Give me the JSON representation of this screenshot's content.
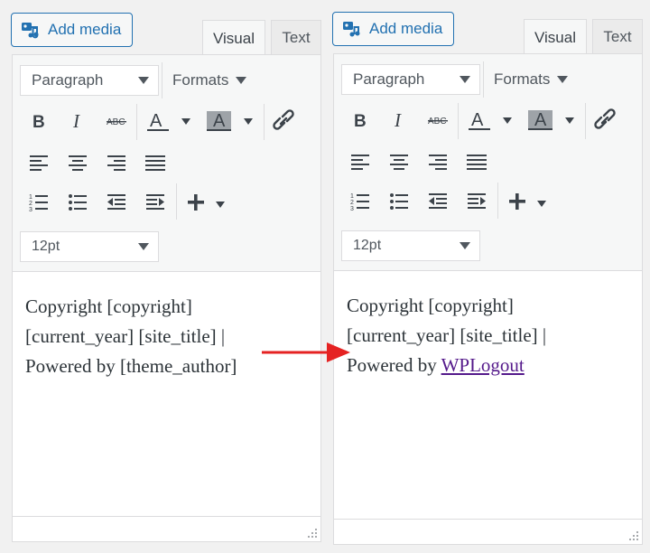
{
  "panels": [
    {
      "add_media": "Add media",
      "tabs": {
        "visual": "Visual",
        "text": "Text"
      },
      "format_select": "Paragraph",
      "formats_menu": "Formats",
      "font_size": "12pt",
      "content": {
        "line1": "Copyright [copyright]",
        "line2": "[current_year] [site_title] |",
        "line3_prefix": "Powered by ",
        "line3_value": "[theme_author]",
        "line3_is_link": false
      }
    },
    {
      "add_media": "Add media",
      "tabs": {
        "visual": "Visual",
        "text": "Text"
      },
      "format_select": "Paragraph",
      "formats_menu": "Formats",
      "font_size": "12pt",
      "content": {
        "line1": "Copyright [copyright]",
        "line2": "[current_year] [site_title] |",
        "line3_prefix": "Powered by ",
        "line3_value": "WPLogout",
        "line3_is_link": true
      }
    }
  ],
  "toolbar_icons": {
    "row1": [
      "bold-icon",
      "italic-icon",
      "strikethrough-icon",
      "text-color-icon",
      "background-color-icon",
      "link-icon"
    ],
    "row2": [
      "align-left-icon",
      "align-center-icon",
      "align-right-icon",
      "justify-icon"
    ],
    "row3": [
      "numbered-list-icon",
      "bullet-list-icon",
      "outdent-icon",
      "indent-icon",
      "insert-icon"
    ]
  },
  "colors": {
    "accent": "#2271b1",
    "toolbar_bg": "#f6f7f7",
    "border": "#dcdcde",
    "text": "#3c434a",
    "link_visited": "#551a8b",
    "arrow": "#e52222"
  }
}
